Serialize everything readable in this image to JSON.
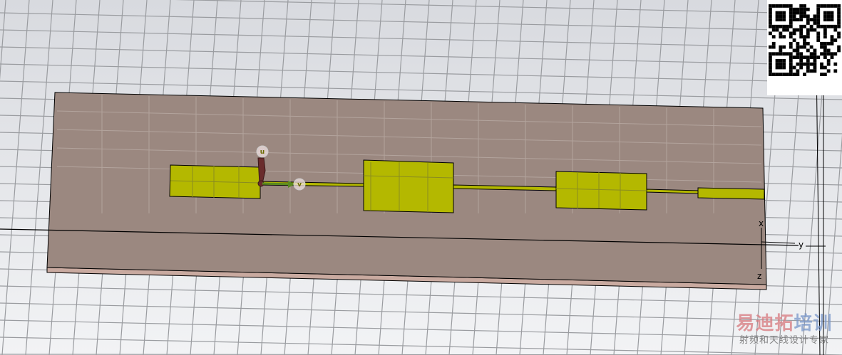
{
  "viewport": {
    "axes": {
      "x": "x",
      "y": "y",
      "z": "z"
    },
    "ports": [
      {
        "label": "u"
      },
      {
        "label": "v"
      }
    ],
    "colors": {
      "background": "#e4e6ea",
      "grid": "#9a9ca0",
      "substrate": "#9b8880",
      "substrate_edge": "#c9aaa0",
      "conductor": "#b4b800"
    }
  },
  "watermark": {
    "title_red": "易迪拓",
    "title_blue": "培训",
    "subtitle": "射频和天线设计专家"
  }
}
